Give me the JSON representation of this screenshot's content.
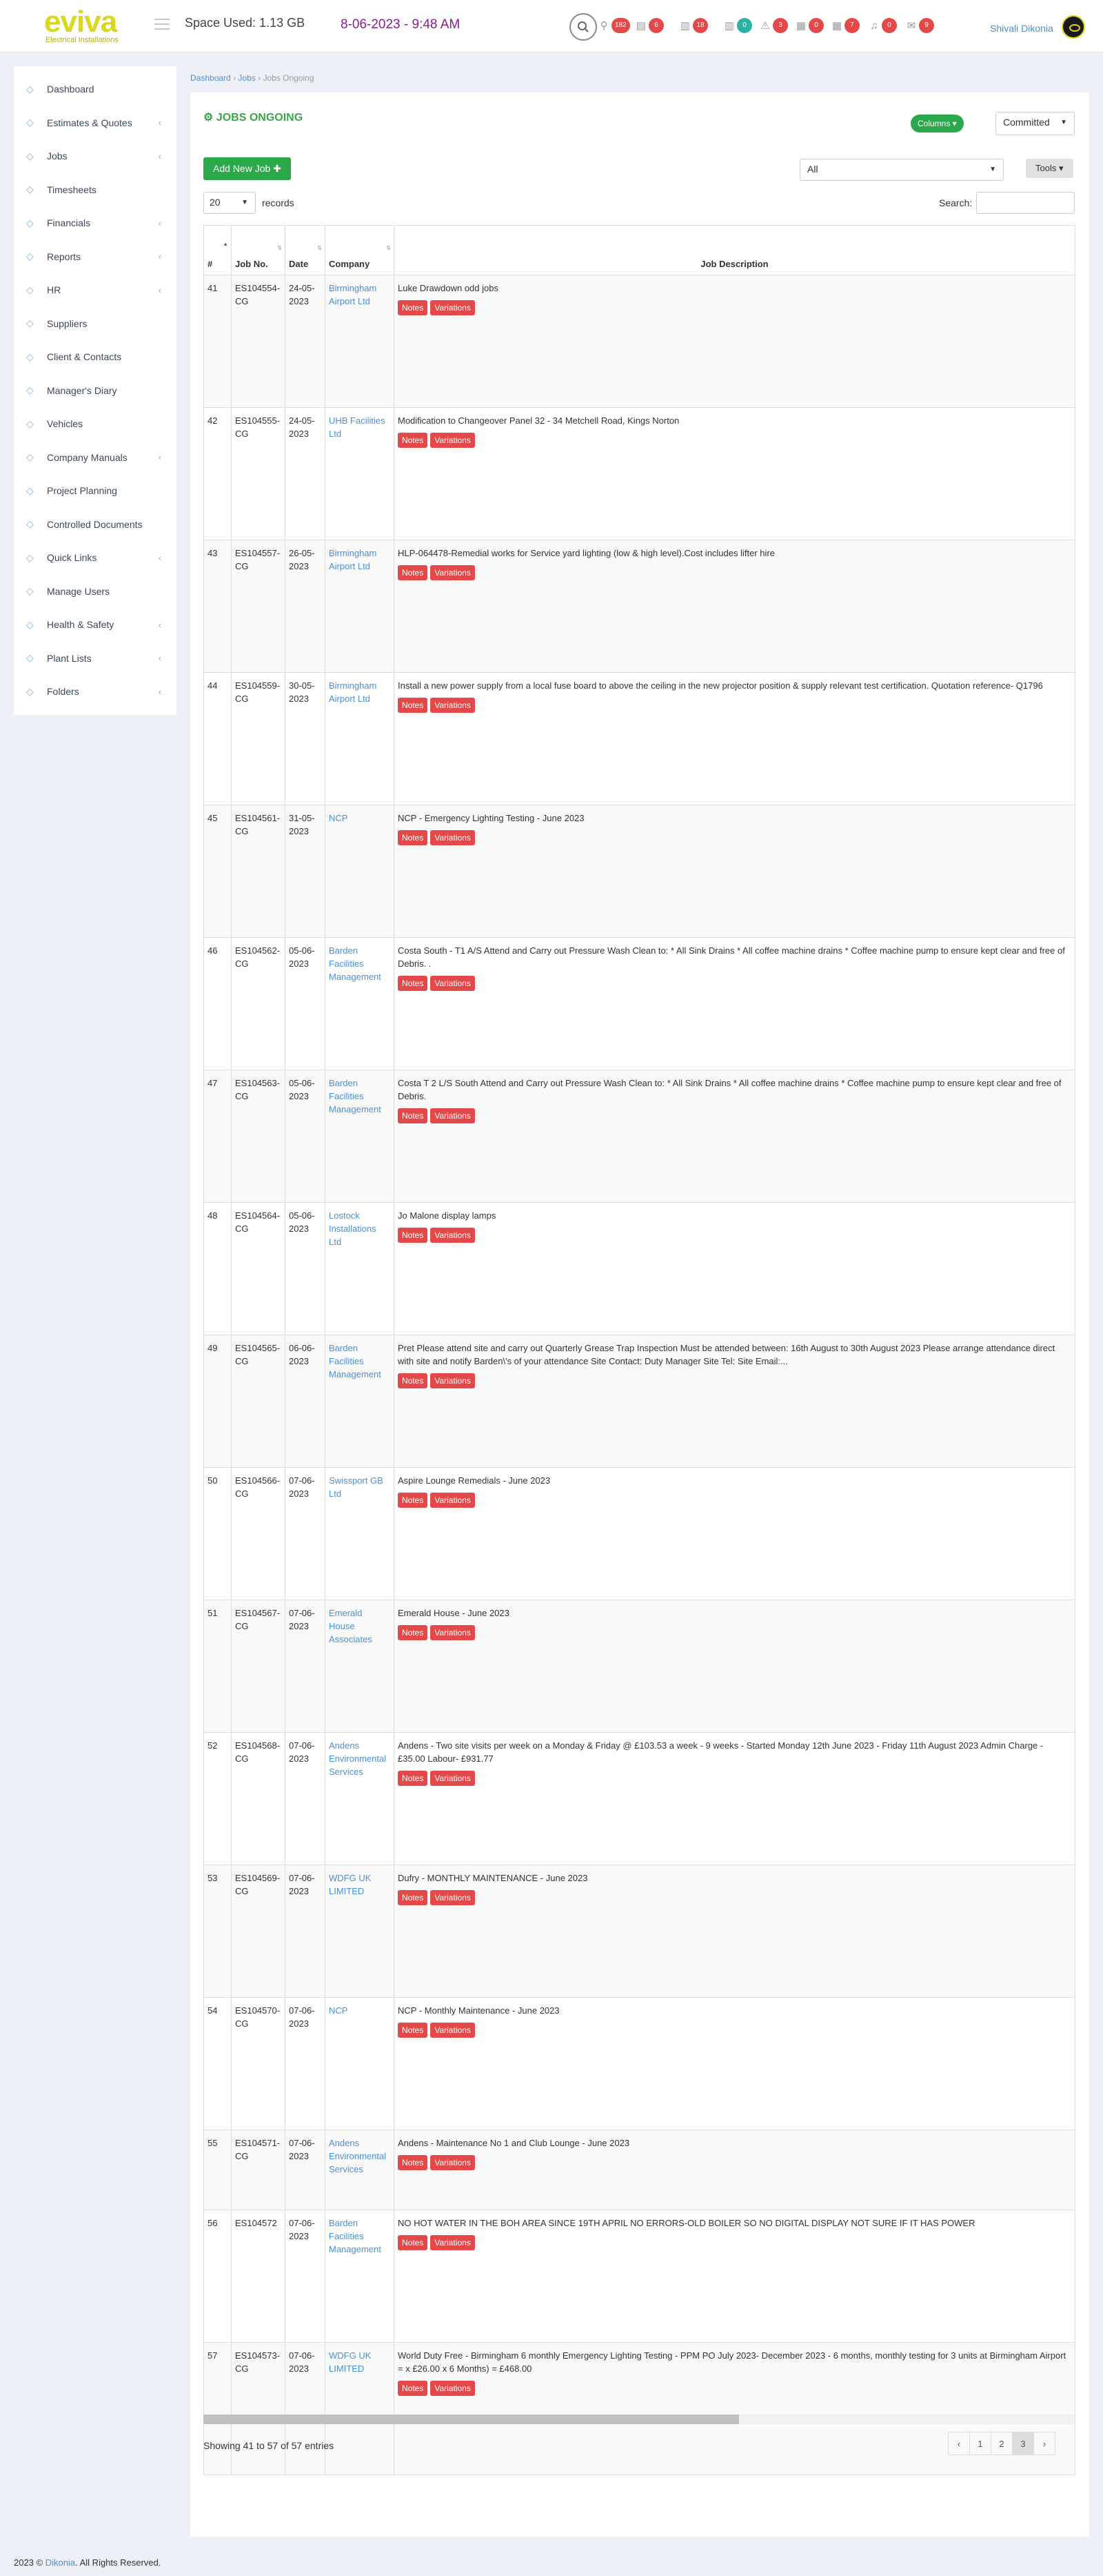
{
  "app": {
    "logo": "eviva",
    "logo_sub": "Electrical Installations",
    "space_used": "Space Used: 1.13 GB",
    "datetime": "8-06-2023 - 9:48 AM",
    "user": "Shivali Dikonia"
  },
  "notifications": [
    {
      "icon": "filter-icon",
      "glyph": "⚲",
      "count": "182",
      "color": "#e54848"
    },
    {
      "icon": "doc-icon",
      "glyph": "▤",
      "count": "6",
      "color": "#e54848"
    },
    {
      "icon": "book-icon",
      "glyph": "▥",
      "count": "18",
      "color": "#e54848"
    },
    {
      "icon": "book-open-icon",
      "glyph": "▥",
      "count": "0",
      "color": "#2ab2a5"
    },
    {
      "icon": "warning-icon",
      "glyph": "⚠",
      "count": "3",
      "color": "#e54848"
    },
    {
      "icon": "calendar-icon",
      "glyph": "▦",
      "count": "0",
      "color": "#e54848"
    },
    {
      "icon": "calendar2-icon",
      "glyph": "▦",
      "count": "7",
      "color": "#e54848"
    },
    {
      "icon": "bell-icon",
      "glyph": "♫",
      "count": "0",
      "color": "#e54848"
    },
    {
      "icon": "mail-icon",
      "glyph": "✉",
      "count": "9",
      "color": "#e54848"
    }
  ],
  "sidebar": {
    "items": [
      {
        "label": "Dashboard",
        "chevron": ""
      },
      {
        "label": "Estimates & Quotes",
        "chevron": "‹"
      },
      {
        "label": "Jobs",
        "chevron": "‹"
      },
      {
        "label": "Timesheets",
        "chevron": ""
      },
      {
        "label": "Financials",
        "chevron": "‹"
      },
      {
        "label": "Reports",
        "chevron": "‹"
      },
      {
        "label": "HR",
        "chevron": "‹"
      },
      {
        "label": "Suppliers",
        "chevron": ""
      },
      {
        "label": "Client & Contacts",
        "chevron": ""
      },
      {
        "label": "Manager's Diary",
        "chevron": ""
      },
      {
        "label": "Vehicles",
        "chevron": ""
      },
      {
        "label": "Company Manuals",
        "chevron": "‹"
      },
      {
        "label": "Project Planning",
        "chevron": ""
      },
      {
        "label": "Controlled Documents",
        "chevron": ""
      },
      {
        "label": "Quick Links",
        "chevron": "‹"
      },
      {
        "label": "Manage Users",
        "chevron": ""
      },
      {
        "label": "Health & Safety",
        "chevron": "‹"
      },
      {
        "label": "Plant Lists",
        "chevron": "‹"
      },
      {
        "label": "Folders",
        "chevron": "‹"
      }
    ]
  },
  "breadcrumb": {
    "home": "Dashboard",
    "jobs": "Jobs",
    "current": "Jobs Ongoing",
    "sep": "›"
  },
  "panel": {
    "title": "JOBS ONGOING",
    "columns_btn": "Columns ▾",
    "status_select": "Committed",
    "add_btn": "Add New Job ✚",
    "filter_select": "All",
    "tools_btn": "Tools ▾",
    "page_size": "20",
    "records_label": "records",
    "search_label": "Search:"
  },
  "table": {
    "headers": [
      "#",
      "Job No.",
      "Date",
      "Company",
      "Job Description"
    ],
    "notes_label": "Notes",
    "variations_label": "Variations",
    "rows": [
      {
        "n": "41",
        "job": "ES104554-CG",
        "date": "24-05-2023",
        "company": "Birmingham Airport Ltd",
        "desc": "Luke Drawdown odd jobs",
        "h": 192
      },
      {
        "n": "42",
        "job": "ES104555-CG",
        "date": "24-05-2023",
        "company": "UHB Facilities Ltd",
        "desc": "Modification to Changeover Panel 32 - 34 Metchell Road, Kings Norton",
        "h": 192
      },
      {
        "n": "43",
        "job": "ES104557-CG",
        "date": "26-05-2023",
        "company": "Birmingham Airport Ltd",
        "desc": "HLP-064478-Remedial works for Service yard lighting (low & high level).Cost includes lifter hire",
        "h": 192
      },
      {
        "n": "44",
        "job": "ES104559-CG",
        "date": "30-05-2023",
        "company": "Birmingham Airport Ltd",
        "desc": "Install a new power supply from a local fuse board to above the ceiling in the new projector position & supply relevant test certification. Quotation reference- Q1796",
        "h": 192
      },
      {
        "n": "45",
        "job": "ES104561-CG",
        "date": "31-05-2023",
        "company": "NCP",
        "desc": "NCP - Emergency Lighting Testing - June 2023",
        "h": 192
      },
      {
        "n": "46",
        "job": "ES104562-CG",
        "date": "05-06-2023",
        "company": "Barden Facilities Management",
        "desc": "Costa South - T1 A/S Attend and Carry out Pressure Wash Clean to: * All Sink Drains  * All coffee machine drains * Coffee machine pump to ensure kept clear and free of Debris. .",
        "h": 192
      },
      {
        "n": "47",
        "job": "ES104563-CG",
        "date": "05-06-2023",
        "company": "Barden Facilities Management",
        "desc": "Costa T 2 L/S South Attend and Carry out Pressure Wash Clean to: * All Sink Drains  * All coffee machine drains * Coffee machine pump to ensure kept clear and free of Debris.",
        "h": 192
      },
      {
        "n": "48",
        "job": "ES104564-CG",
        "date": "05-06-2023",
        "company": "Lostock Installations Ltd",
        "desc": "Jo Malone display lamps",
        "h": 192
      },
      {
        "n": "49",
        "job": "ES104565-CG",
        "date": "06-06-2023",
        "company": "Barden Facilities Management",
        "desc": "Pret Please attend site and carry out Quarterly Grease Trap Inspection Must be attended between: 16th August to 30th August 2023 Please arrange attendance direct with site and notify Barden\\'s of your attendance Site Contact: Duty Manager Site Tel: Site Email:...",
        "h": 192
      },
      {
        "n": "50",
        "job": "ES104566-CG",
        "date": "07-06-2023",
        "company": "Swissport GB Ltd",
        "desc": "Aspire Lounge Remedials - June 2023",
        "h": 192
      },
      {
        "n": "51",
        "job": "ES104567-CG",
        "date": "07-06-2023",
        "company": "Emerald House Associates",
        "desc": "Emerald House - June 2023",
        "h": 192
      },
      {
        "n": "52",
        "job": "ES104568-CG",
        "date": "07-06-2023",
        "company": "Andens Environmental Services",
        "desc": "Andens - Two site visits per week on a Monday & Friday @ £103.53 a week - 9 weeks - Started Monday 12th June 2023 - Friday 11th August 2023 Admin Charge - £35.00 Labour- £931.77",
        "h": 192
      },
      {
        "n": "53",
        "job": "ES104569-CG",
        "date": "07-06-2023",
        "company": "WDFG UK LIMITED",
        "desc": "Dufry - MONTHLY MAINTENANCE - June 2023",
        "h": 192
      },
      {
        "n": "54",
        "job": "ES104570-CG",
        "date": "07-06-2023",
        "company": "NCP",
        "desc": "NCP - Monthly Maintenance - June 2023",
        "h": 192
      },
      {
        "n": "55",
        "job": "ES104571-CG",
        "date": "07-06-2023",
        "company": "Andens Environmental Services",
        "desc": "Andens - Maintenance No 1 and Club Lounge - June 2023",
        "h": 116
      },
      {
        "n": "56",
        "job": "ES104572",
        "date": "07-06-2023",
        "company": "Barden Facilities Management",
        "desc": "NO HOT WATER IN THE BOH AREA SINCE 19TH APRIL NO ERRORS-OLD BOILER SO NO DIGITAL DISPLAY NOT SURE IF IT HAS POWER",
        "h": 192
      },
      {
        "n": "57",
        "job": "ES104573-CG",
        "date": "07-06-2023",
        "company": "WDFG UK LIMITED",
        "desc": "World Duty Free - Birmingham 6 monthly Emergency Lighting Testing - PPM PO July 2023- December 2023 - 6 months, monthly testing for 3 units at Birmingham Airport = x £26.00 x 6 Months) = £468.00",
        "h": 192
      }
    ]
  },
  "footer_table": {
    "showing": "Showing 41 to 57 of 57 entries",
    "prev": "‹",
    "pages": [
      "1",
      "2",
      "3"
    ],
    "next": "›"
  },
  "footer": {
    "copy": "2023 ©",
    "company": "Dikonia",
    "rights": ". All Rights Reserved."
  }
}
